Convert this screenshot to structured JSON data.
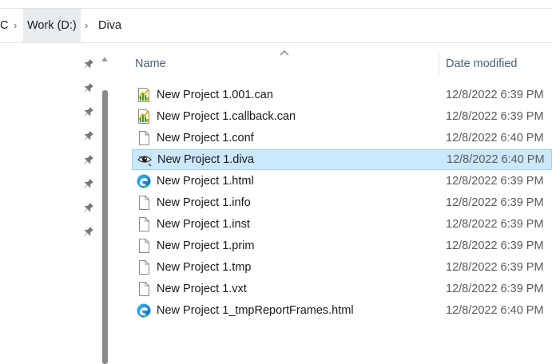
{
  "breadcrumb": {
    "items": [
      {
        "label": "C"
      },
      {
        "label": "Work (D:)"
      },
      {
        "label": "Diva"
      }
    ]
  },
  "columns": {
    "name": "Name",
    "date_modified": "Date modified"
  },
  "files": [
    {
      "name": "New Project 1.001.can",
      "date": "12/8/2022 6:39 PM",
      "icon": "chart-file-icon"
    },
    {
      "name": "New Project 1.callback.can",
      "date": "12/8/2022 6:39 PM",
      "icon": "chart-file-icon"
    },
    {
      "name": "New Project 1.conf",
      "date": "12/8/2022 6:40 PM",
      "icon": "blank-file-icon"
    },
    {
      "name": "New Project 1.diva",
      "date": "12/8/2022 6:40 PM",
      "icon": "eye-file-icon",
      "selected": true
    },
    {
      "name": "New Project 1.html",
      "date": "12/8/2022 6:39 PM",
      "icon": "edge-icon"
    },
    {
      "name": "New Project 1.info",
      "date": "12/8/2022 6:39 PM",
      "icon": "blank-file-icon"
    },
    {
      "name": "New Project 1.inst",
      "date": "12/8/2022 6:39 PM",
      "icon": "blank-file-icon"
    },
    {
      "name": "New Project 1.prim",
      "date": "12/8/2022 6:39 PM",
      "icon": "blank-file-icon"
    },
    {
      "name": "New Project 1.tmp",
      "date": "12/8/2022 6:39 PM",
      "icon": "blank-file-icon"
    },
    {
      "name": "New Project 1.vxt",
      "date": "12/8/2022 6:39 PM",
      "icon": "blank-file-icon"
    },
    {
      "name": "New Project 1_tmpReportFrames.html",
      "date": "12/8/2022 6:40 PM",
      "icon": "edge-icon"
    }
  ],
  "colors": {
    "selection_bg": "#cce8ff",
    "selection_border": "#99d1ff",
    "header_text": "#4c607a",
    "breadcrumb_highlight": "#e8ecf1"
  }
}
